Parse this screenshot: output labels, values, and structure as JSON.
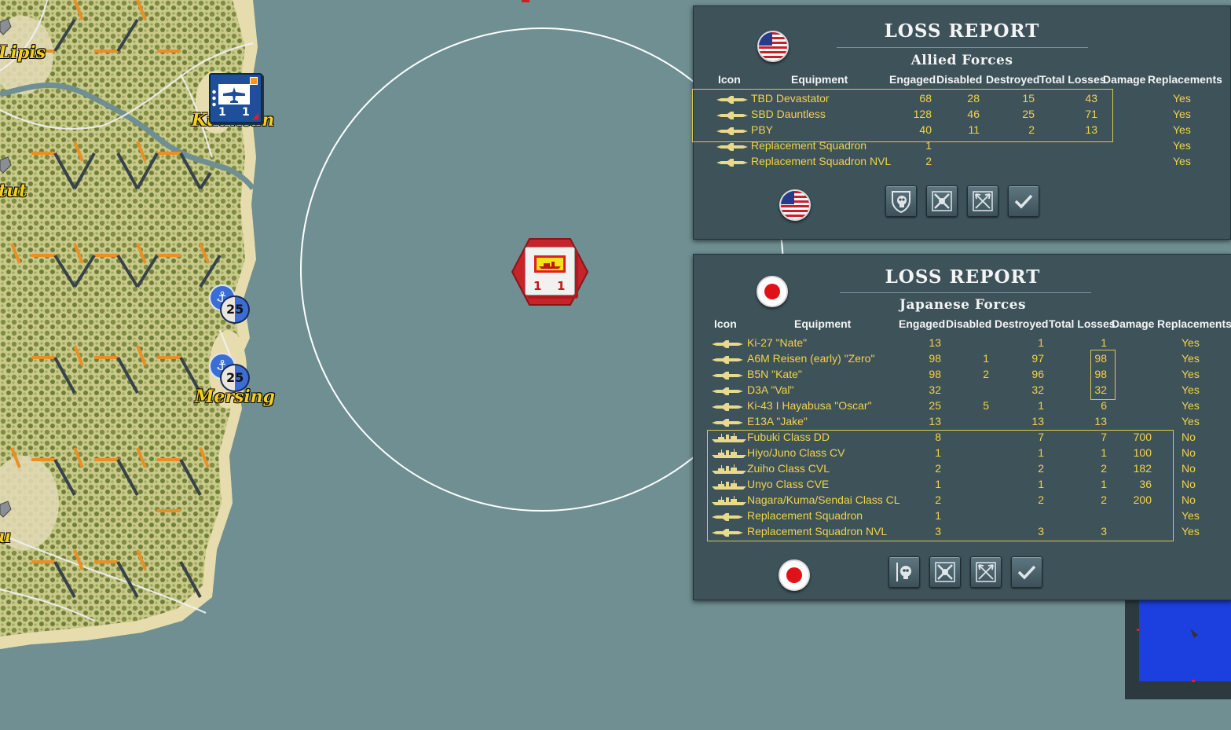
{
  "map": {
    "places": [
      {
        "name": "Lipis"
      },
      {
        "name": "Kuantan"
      },
      {
        "name": "tut"
      },
      {
        "name": "Mersing"
      },
      {
        "name": "u"
      }
    ],
    "air_unit": {
      "left_value": "1",
      "right_value": "1"
    },
    "naval_stack_1": {
      "value": "25"
    },
    "naval_stack_2": {
      "value": "25"
    },
    "enemy_task_force": {
      "left_value": "1",
      "right_value": "1"
    }
  },
  "allied_report": {
    "title": "LOSS REPORT",
    "subtitle": "Allied Forces",
    "columns": [
      "Icon",
      "Equipment",
      "Engaged",
      "Disabled",
      "Destroyed",
      "Total Losses",
      "Damage",
      "Replacements"
    ],
    "rows": [
      {
        "type": "aircraft",
        "equipment": "TBD Devastator",
        "engaged": "68",
        "disabled": "28",
        "destroyed": "15",
        "total_losses": "43",
        "damage": "",
        "replacements": "Yes"
      },
      {
        "type": "aircraft",
        "equipment": "SBD Dauntless",
        "engaged": "128",
        "disabled": "46",
        "destroyed": "25",
        "total_losses": "71",
        "damage": "",
        "replacements": "Yes"
      },
      {
        "type": "aircraft",
        "equipment": "PBY",
        "engaged": "40",
        "disabled": "11",
        "destroyed": "2",
        "total_losses": "13",
        "damage": "",
        "replacements": "Yes"
      },
      {
        "type": "aircraft",
        "equipment": "Replacement Squadron",
        "engaged": "1",
        "disabled": "",
        "destroyed": "",
        "total_losses": "",
        "damage": "",
        "replacements": "Yes"
      },
      {
        "type": "aircraft",
        "equipment": "Replacement Squadron NVL",
        "engaged": "2",
        "disabled": "",
        "destroyed": "",
        "total_losses": "",
        "damage": "",
        "replacements": "Yes"
      }
    ],
    "buttons": [
      "skull-shield-icon",
      "crossed-swords-icon",
      "crossed-arrows-icon",
      "checkmark-icon"
    ]
  },
  "japanese_report": {
    "title": "LOSS REPORT",
    "subtitle": "Japanese Forces",
    "columns": [
      "Icon",
      "Equipment",
      "Engaged",
      "Disabled",
      "Destroyed",
      "Total Losses",
      "Damage",
      "Replacements"
    ],
    "rows": [
      {
        "type": "aircraft",
        "equipment": "Ki-27 \"Nate\"",
        "engaged": "13",
        "disabled": "",
        "destroyed": "1",
        "total_losses": "1",
        "damage": "",
        "replacements": "Yes"
      },
      {
        "type": "aircraft",
        "equipment": "A6M Reisen (early) \"Zero\"",
        "engaged": "98",
        "disabled": "1",
        "destroyed": "97",
        "total_losses": "98",
        "damage": "",
        "replacements": "Yes"
      },
      {
        "type": "aircraft",
        "equipment": "B5N \"Kate\"",
        "engaged": "98",
        "disabled": "2",
        "destroyed": "96",
        "total_losses": "98",
        "damage": "",
        "replacements": "Yes"
      },
      {
        "type": "aircraft",
        "equipment": "D3A \"Val\"",
        "engaged": "32",
        "disabled": "",
        "destroyed": "32",
        "total_losses": "32",
        "damage": "",
        "replacements": "Yes"
      },
      {
        "type": "aircraft",
        "equipment": "Ki-43 I Hayabusa \"Oscar\"",
        "engaged": "25",
        "disabled": "5",
        "destroyed": "1",
        "total_losses": "6",
        "damage": "",
        "replacements": "Yes"
      },
      {
        "type": "aircraft",
        "equipment": "E13A \"Jake\"",
        "engaged": "13",
        "disabled": "",
        "destroyed": "13",
        "total_losses": "13",
        "damage": "",
        "replacements": "Yes"
      },
      {
        "type": "ship",
        "equipment": "Fubuki Class DD",
        "engaged": "8",
        "disabled": "",
        "destroyed": "7",
        "total_losses": "7",
        "damage": "700",
        "replacements": "No"
      },
      {
        "type": "ship",
        "equipment": "Hiyo/Juno Class CV",
        "engaged": "1",
        "disabled": "",
        "destroyed": "1",
        "total_losses": "1",
        "damage": "100",
        "replacements": "No"
      },
      {
        "type": "ship",
        "equipment": "Zuiho Class CVL",
        "engaged": "2",
        "disabled": "",
        "destroyed": "2",
        "total_losses": "2",
        "damage": "182",
        "replacements": "No"
      },
      {
        "type": "ship",
        "equipment": "Unyo Class CVE",
        "engaged": "1",
        "disabled": "",
        "destroyed": "1",
        "total_losses": "1",
        "damage": "36",
        "replacements": "No"
      },
      {
        "type": "ship",
        "equipment": "Nagara/Kuma/Sendai Class CL",
        "engaged": "2",
        "disabled": "",
        "destroyed": "2",
        "total_losses": "2",
        "damage": "200",
        "replacements": "No"
      },
      {
        "type": "aircraft",
        "equipment": "Replacement Squadron",
        "engaged": "1",
        "disabled": "",
        "destroyed": "",
        "total_losses": "",
        "damage": "",
        "replacements": "Yes"
      },
      {
        "type": "aircraft",
        "equipment": "Replacement Squadron NVL",
        "engaged": "3",
        "disabled": "",
        "destroyed": "3",
        "total_losses": "3",
        "damage": "",
        "replacements": "Yes"
      }
    ],
    "buttons": [
      "skull-sword-icon",
      "crossed-swords-icon",
      "crossed-arrows-icon",
      "checkmark-icon"
    ]
  },
  "colors": {
    "panel_bg": "#3e525a",
    "text_gold": "#f2d34a",
    "highlight": "#d9c94a",
    "sea": "#6f8f92"
  }
}
